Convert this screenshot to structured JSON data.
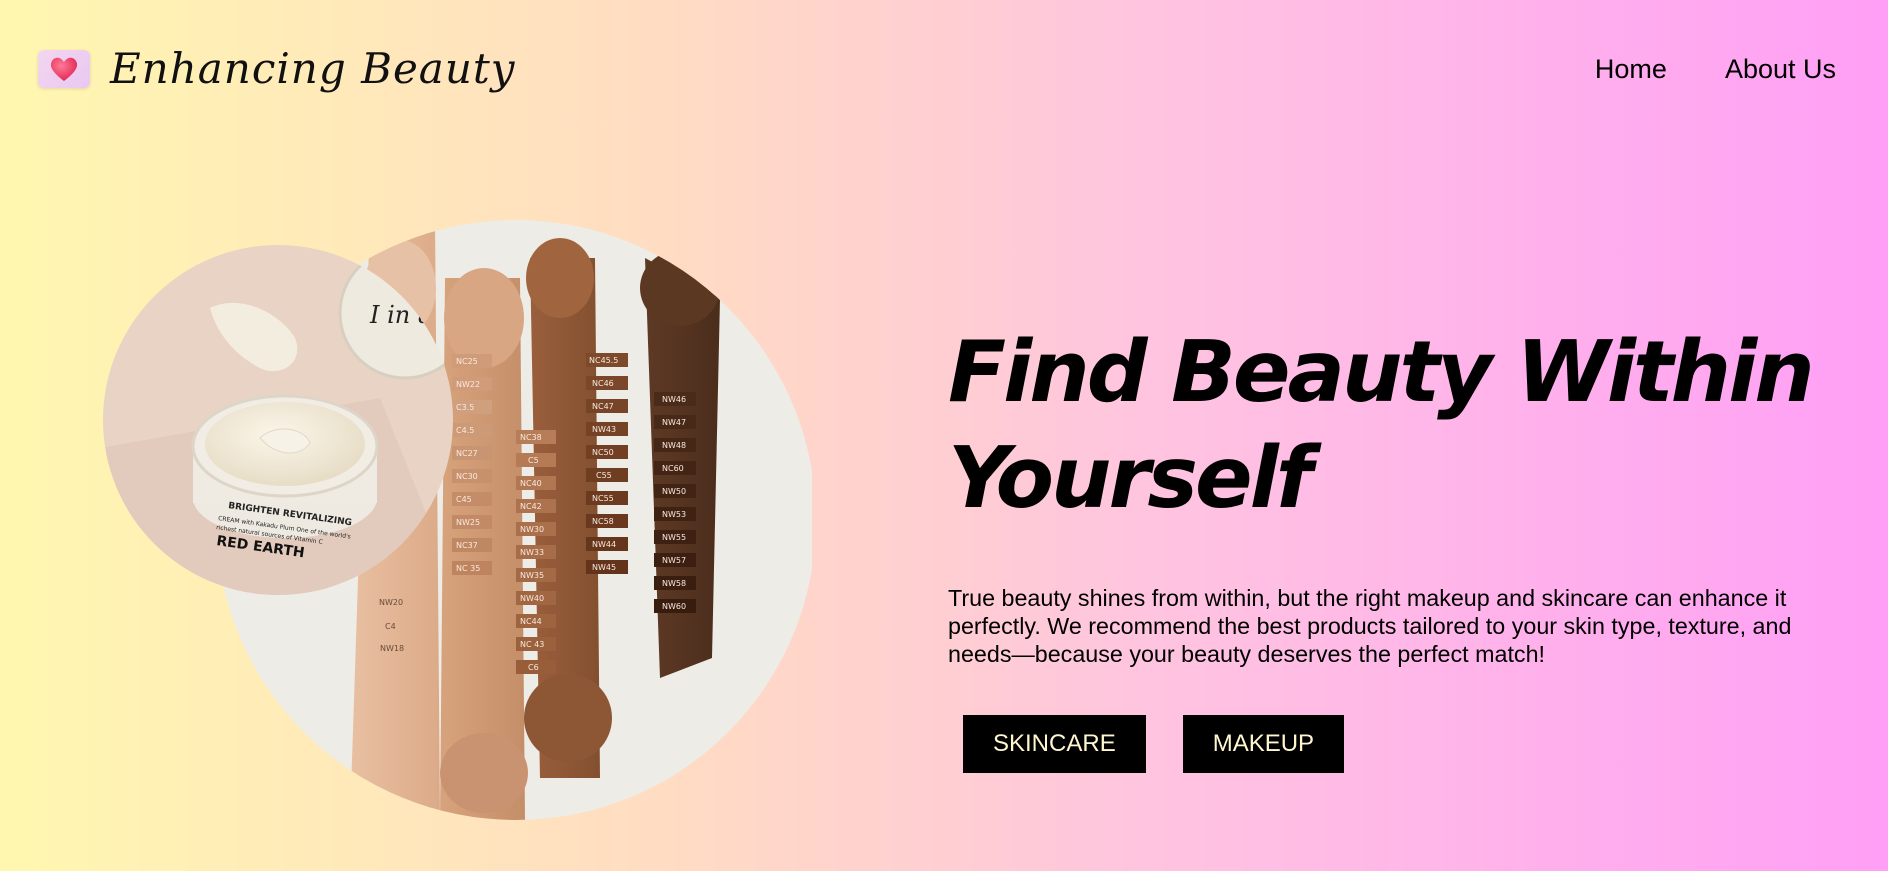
{
  "brand": {
    "name": "Enhancing Beauty",
    "logo_icon": "heart-icon",
    "logo_color": "#f0406a"
  },
  "nav": {
    "items": [
      {
        "label": "Home"
      },
      {
        "label": "About Us"
      }
    ]
  },
  "hero": {
    "title": "Find Beauty Within Yourself",
    "description": "True beauty shines from within, but the right makeup and skincare can enhance it perfectly. We recommend the best products tailored to your skin type, texture, and needs—because your beauty deserves the perfect match!",
    "buttons": [
      {
        "label": "SKINCARE"
      },
      {
        "label": "MAKEUP"
      }
    ]
  },
  "image": {
    "jar_label_title": "BRIGHTEN REVITALIZING",
    "jar_label_sub": "CREAM with Kakadu Plum One of the world's",
    "jar_label_sub2": "richest natural sources of Vitamin C",
    "jar_brand": "RED EARTH",
    "lid_text": "I in a bag",
    "arm1_swatches": [
      "NC25",
      "NW22",
      "C3.5",
      "C4.5",
      "NC27",
      "NC30",
      "C45",
      "NW25",
      "NC37",
      "NC 35"
    ],
    "arm1_lower": [
      "NW20",
      "C4",
      "NW18"
    ],
    "arm2_swatches": [
      "NC38",
      "C5",
      "NC40",
      "NC42",
      "NW30",
      "NW33",
      "NW35",
      "NW40",
      "NC44",
      "NC 43",
      "C6"
    ],
    "arm3_swatches": [
      "NC45.5",
      "NC46",
      "NC47",
      "NW43",
      "NC50",
      "C55",
      "NC55",
      "NC58",
      "NW44",
      "NW45"
    ],
    "arm4_swatches": [
      "NW46",
      "NW47",
      "NW48",
      "NC60",
      "NW50",
      "NW53",
      "NW55",
      "NW57",
      "NW58",
      "NW60"
    ]
  },
  "colors": {
    "accent": "#000000",
    "button_text": "#fff6cf"
  }
}
